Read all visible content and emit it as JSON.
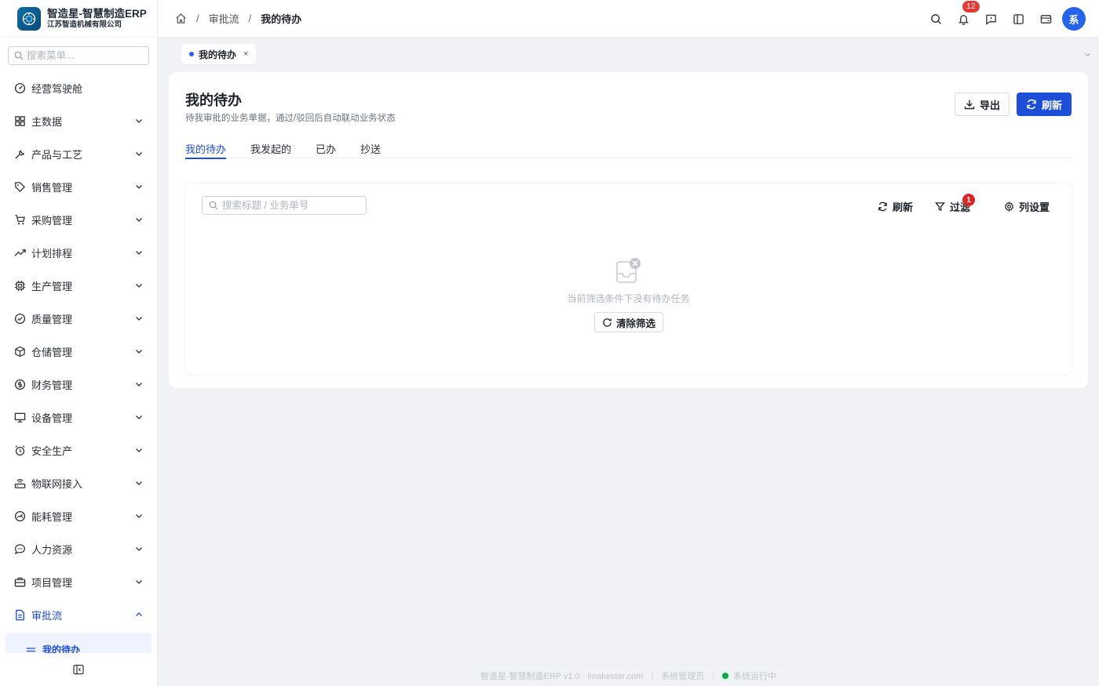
{
  "brand": {
    "title": "智造星-智慧制造ERP",
    "subtitle": "江苏智造机械有限公司",
    "logo_icon": "chip-logo-icon"
  },
  "sidebar": {
    "search_placeholder": "搜索菜单...",
    "items": [
      {
        "label": "经营驾驶舱",
        "icon": "dashboard-icon",
        "has_children": false
      },
      {
        "label": "主数据",
        "icon": "grid-icon",
        "has_children": true
      },
      {
        "label": "产品与工艺",
        "icon": "wrench-icon",
        "has_children": true
      },
      {
        "label": "销售管理",
        "icon": "tag-icon",
        "has_children": true
      },
      {
        "label": "采购管理",
        "icon": "cart-icon",
        "has_children": true
      },
      {
        "label": "计划排程",
        "icon": "trend-icon",
        "has_children": true
      },
      {
        "label": "生产管理",
        "icon": "cpu-icon",
        "has_children": true
      },
      {
        "label": "质量管理",
        "icon": "check-circle-icon",
        "has_children": true
      },
      {
        "label": "仓储管理",
        "icon": "box-icon",
        "has_children": true
      },
      {
        "label": "财务管理",
        "icon": "dollar-icon",
        "has_children": true
      },
      {
        "label": "设备管理",
        "icon": "monitor-icon",
        "has_children": true
      },
      {
        "label": "安全生产",
        "icon": "alarm-icon",
        "has_children": true
      },
      {
        "label": "物联网接入",
        "icon": "router-icon",
        "has_children": true
      },
      {
        "label": "能耗管理",
        "icon": "gauge-icon",
        "has_children": true
      },
      {
        "label": "人力资源",
        "icon": "chat-icon",
        "has_children": true
      },
      {
        "label": "项目管理",
        "icon": "briefcase-icon",
        "has_children": true
      },
      {
        "label": "审批流",
        "icon": "document-icon",
        "has_children": true,
        "expanded": true,
        "active": true
      }
    ],
    "sub_item": "我的待办"
  },
  "breadcrumb": {
    "items": [
      "审批流",
      "我的待办"
    ]
  },
  "header": {
    "notification_count": "12",
    "avatar_text": "系"
  },
  "page_tab": {
    "label": "我的待办",
    "close": "×"
  },
  "page": {
    "title": "我的待办",
    "subtitle": "待我审批的业务单据，通过/驳回后自动联动业务状态",
    "export_label": "导出",
    "refresh_label": "刷新",
    "tabs": [
      "我的待办",
      "我发起的",
      "已办",
      "抄送"
    ],
    "active_tab": 0
  },
  "table_toolbar": {
    "search_placeholder": "搜索标题 / 业务单号",
    "refresh_label": "刷新",
    "filter_label": "过滤",
    "filter_badge": "1",
    "columns_label": "列设置"
  },
  "empty_state": {
    "text": "当前筛选条件下没有待办任务",
    "clear_label": "清除筛选"
  },
  "footer": {
    "version": "智造星-智慧制造ERP v1.0 · imakestar.com",
    "user": "系统管理员",
    "status": "系统运行中"
  },
  "colors": {
    "primary": "#1d4ed8",
    "badge": "#e53935",
    "status_ok": "#16a34a"
  }
}
